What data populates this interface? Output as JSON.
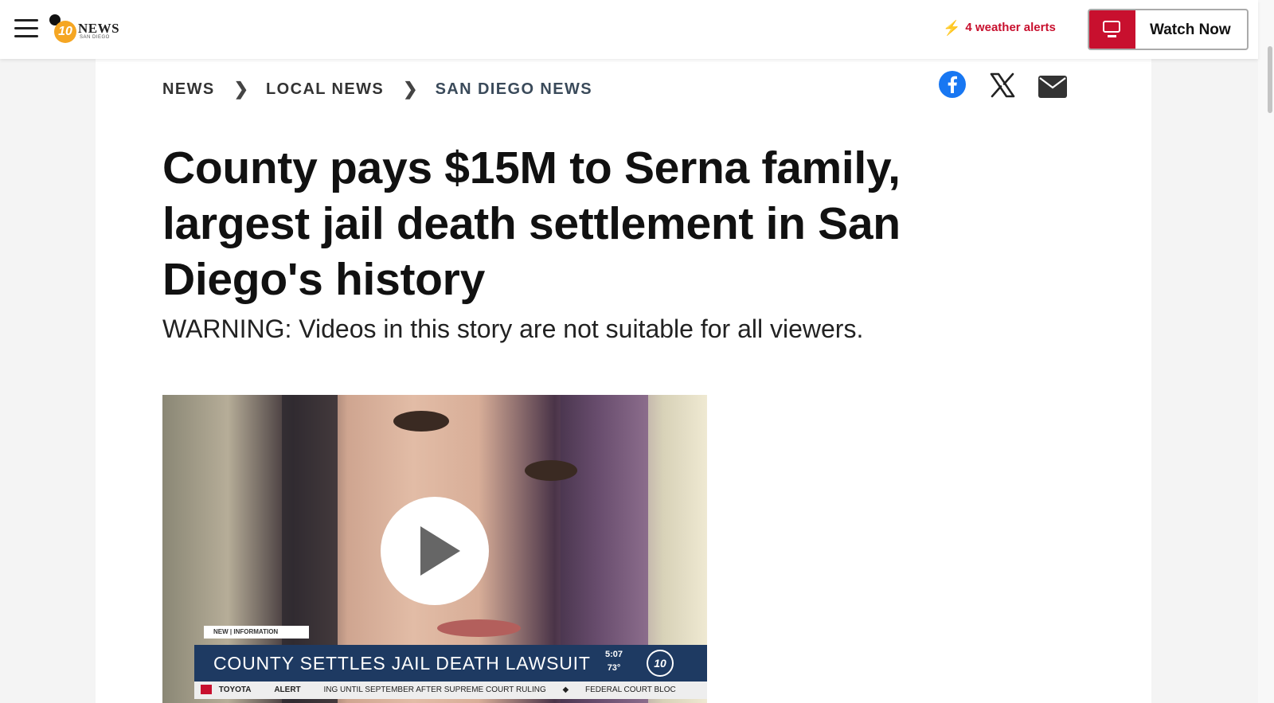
{
  "header": {
    "logo": {
      "circle_text": "10",
      "word": "NEWS",
      "subword": "SAN DIEGO"
    },
    "alerts_text": "4 weather alerts",
    "watch_label": "Watch Now"
  },
  "breadcrumbs": [
    {
      "label": "NEWS"
    },
    {
      "label": "LOCAL NEWS"
    },
    {
      "label": "SAN DIEGO NEWS"
    }
  ],
  "share_icons": [
    "facebook-icon",
    "x-icon",
    "email-icon"
  ],
  "article": {
    "headline": "County pays $15M to Serna family, largest jail death settlement in San Diego's history",
    "warning": "WARNING: Videos in this story are not suitable for all viewers."
  },
  "video": {
    "tag_text": "NEW | INFORMATION",
    "lower_third": "COUNTY SETTLES JAIL DEATH LAWSUIT",
    "time": "5:07",
    "temp": "73°",
    "badge": "10",
    "ticker": {
      "sponsor": "TOYOTA",
      "label": "ALERT",
      "text1": "ING UNTIL SEPTEMBER AFTER SUPREME COURT RULING",
      "text2": "FEDERAL COURT BLOC"
    }
  },
  "colors": {
    "accent_red": "#c8102e",
    "lower_third_blue": "#1e3a62"
  }
}
